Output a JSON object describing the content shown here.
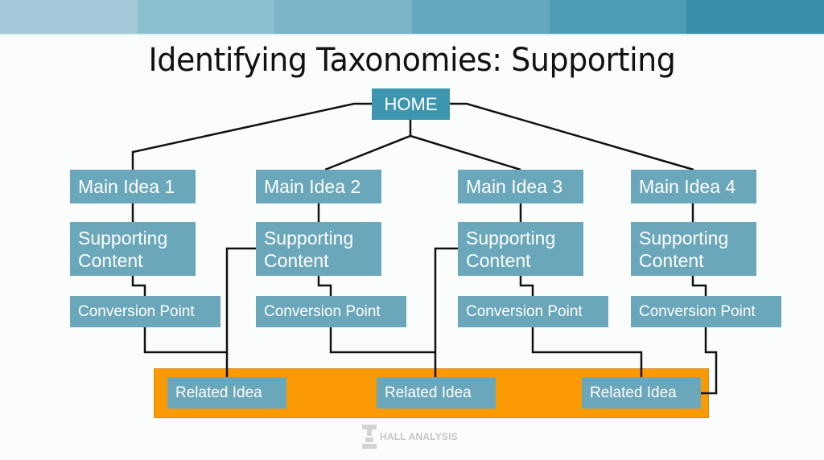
{
  "header": {
    "band_colors": [
      "#a3c9d8",
      "#8cc0d0",
      "#7ab4c6",
      "#63a8be",
      "#4e9db6",
      "#3b8faa"
    ]
  },
  "title": "Identifying Taxonomies: Supporting",
  "diagram": {
    "root": "HOME",
    "columns": [
      {
        "main": "Main Idea 1",
        "supporting": [
          "Supporting",
          "Content"
        ],
        "conversion": "Conversion Point"
      },
      {
        "main": "Main Idea 2",
        "supporting": [
          "Supporting",
          "Content"
        ],
        "conversion": "Conversion Point"
      },
      {
        "main": "Main Idea 3",
        "supporting": [
          "Supporting",
          "Content"
        ],
        "conversion": "Conversion Point"
      },
      {
        "main": "Main Idea 4",
        "supporting": [
          "Supporting",
          "Content"
        ],
        "conversion": "Conversion Point"
      }
    ],
    "related": [
      "Related Idea",
      "Related Idea",
      "Related Idea"
    ],
    "colors": {
      "home": "#3d95b0",
      "node": "#6ba7bb",
      "related_band": "#fb9a02",
      "connector": "#111111"
    }
  },
  "footer": {
    "logo_text": "HALL ANALYSIS"
  }
}
